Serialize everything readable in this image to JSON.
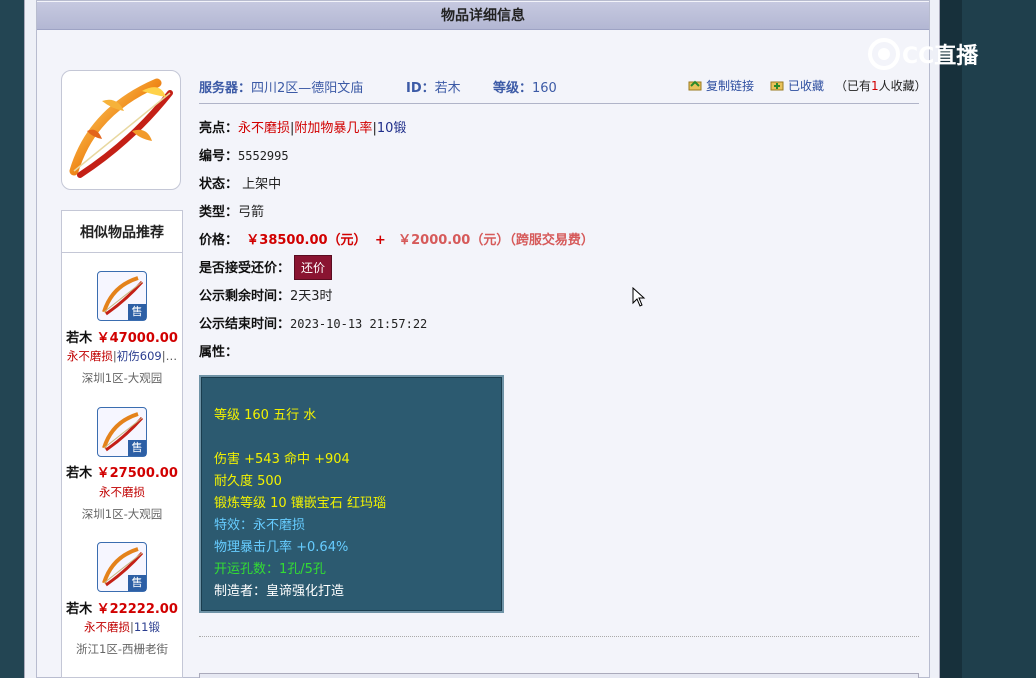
{
  "page": {
    "title": "物品详细信息"
  },
  "similar": {
    "title": "相似物品推荐",
    "sale_badge": "售",
    "items": [
      {
        "server": "若木",
        "price": "￥47000.00",
        "tags": [
          {
            "text": "永不磨损",
            "c": "red"
          },
          {
            "text": "|",
            "c": "sep"
          },
          {
            "text": "初伤609",
            "c": "blue"
          },
          {
            "text": "|…",
            "c": "sep"
          }
        ],
        "location": "深圳1区-大观园"
      },
      {
        "server": "若木",
        "price": "￥27500.00",
        "tags": [
          {
            "text": "永不磨损",
            "c": "red"
          }
        ],
        "location": "深圳1区-大观园"
      },
      {
        "server": "若木",
        "price": "￥22222.00",
        "tags": [
          {
            "text": "永不磨损",
            "c": "red"
          },
          {
            "text": "|",
            "c": "sep"
          },
          {
            "text": "11锻",
            "c": "blue"
          }
        ],
        "location": "浙江1区-西栅老街"
      }
    ]
  },
  "header": {
    "server_label": "服务器：",
    "server_value": "四川2区—德阳文庙",
    "id_label": "ID：",
    "id_value": "若木",
    "level_label": "等级：",
    "level_value": "160",
    "copy_link": "复制链接",
    "favorited": "已收藏",
    "fav_count_prefix": "（已有",
    "fav_count": "1",
    "fav_count_suffix": "人收藏）"
  },
  "details": {
    "highlight_label": "亮点：",
    "highlights": [
      "永不磨损",
      "附加物暴几率",
      "10锻"
    ],
    "number_label": "编号：",
    "number_value": "5552995",
    "status_label": "状态：",
    "status_value": "上架中",
    "type_label": "类型：",
    "type_value": "弓箭",
    "price_label": "价格：",
    "price_value": "￥38500.00（元）",
    "price_plus": "+",
    "fee_value": "￥2000.00（元）（跨服交易费）",
    "counter_label": "是否接受还价：",
    "counter_button": "还价",
    "remaining_label": "公示剩余时间：",
    "remaining_value": "2天3时",
    "end_label": "公示结束时间：",
    "end_value": "2023-10-13 21:57:22",
    "attr_label": "属性："
  },
  "attributes": [
    {
      "text": "等级 160 五行 水",
      "color": "y"
    },
    {
      "text": "",
      "color": "y"
    },
    {
      "text": "伤害 +543 命中 +904",
      "color": "y"
    },
    {
      "text": "耐久度 500",
      "color": "y"
    },
    {
      "text": "锻炼等级 10 镶嵌宝石 红玛瑙",
      "color": "y"
    },
    {
      "text": "特效：永不磨损",
      "color": "b"
    },
    {
      "text": "物理暴击几率 +0.64%",
      "color": "b"
    },
    {
      "text": "开运孔数：1孔/5孔",
      "color": "g"
    },
    {
      "text": "制造者：皇谛强化打造",
      "color": "w"
    }
  ],
  "watermark": "CC直播"
}
